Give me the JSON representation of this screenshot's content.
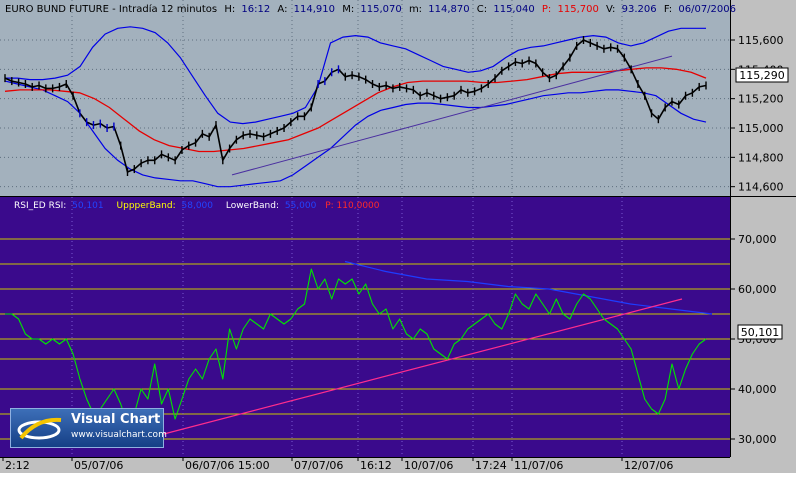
{
  "price_panel": {
    "header": {
      "symbol": "EURO BUND FUTURE - Intradía 12 minutos",
      "hour_label": "H:",
      "hour": "16:12",
      "open_label": "A:",
      "open": "114,910",
      "high_label": "M:",
      "high": "115,070",
      "low_label": "m:",
      "low": "114,870",
      "close_label": "C:",
      "close": "115,040",
      "p_label": "P:",
      "p": "115,700",
      "volume_label": "V:",
      "volume": "93.206",
      "date_label": "F:",
      "date": "06/07/2006"
    },
    "last_value_label": "115,290",
    "colors": {
      "background": "#a3b1bd",
      "price": "#000000",
      "price_alt": "#0000c8",
      "bands": "#0000e6",
      "average": "#e60000",
      "trendline": "#4a2fa0",
      "axis": "#000000"
    }
  },
  "rsi_panel": {
    "header": {
      "rsi_label": "RSI_ED RSI:",
      "rsi_value": "50,101",
      "upper_label": "UppperBand:",
      "upper_value": "58,000",
      "lower_label": "LowerBand:",
      "lower_value": "55,000",
      "p_text": "P: 110,0000"
    },
    "last_value_label": "50,101",
    "colors": {
      "background": "#3a0a8c",
      "rsi": "#00e600",
      "bands": "#1e3cff",
      "trendline": "#ff2d8c",
      "levels": "#c8c800",
      "header_text": "#ffffff"
    }
  },
  "x_axis": {
    "labels": [
      "2:12",
      "05/07/06",
      "06/07/06 15:00",
      "07/07/06",
      "16:12",
      "10/07/06",
      "17:24",
      "11/07/06",
      "12/07/06"
    ]
  },
  "logo": {
    "title": "Visual Chart",
    "url": "www.visualchart.com"
  },
  "chart_data": [
    {
      "type": "line",
      "title": "EURO BUND FUTURE - Intradía 12 minutos",
      "ylim": [
        114.55,
        115.75
      ],
      "y_ticks": [
        "115,600",
        "115,400",
        "115,200",
        "115,000",
        "114,800",
        "114,600"
      ],
      "y_tick_values": [
        115.6,
        115.4,
        115.2,
        115.0,
        114.8,
        114.6
      ],
      "series": [
        {
          "name": "Price",
          "values": [
            115.34,
            115.32,
            115.31,
            115.3,
            115.28,
            115.29,
            115.27,
            115.27,
            115.28,
            115.3,
            115.22,
            115.1,
            115.04,
            115.02,
            115.03,
            115.0,
            115.01,
            114.88,
            114.7,
            114.72,
            114.76,
            114.78,
            114.78,
            114.82,
            114.8,
            114.78,
            114.85,
            114.88,
            114.9,
            114.96,
            114.94,
            115.02,
            114.78,
            114.86,
            114.92,
            114.95,
            114.96,
            114.95,
            114.94,
            114.96,
            114.98,
            115.0,
            115.04,
            115.08,
            115.08,
            115.14,
            115.3,
            115.32,
            115.38,
            115.4,
            115.35,
            115.36,
            115.35,
            115.33,
            115.3,
            115.28,
            115.29,
            115.27,
            115.28,
            115.27,
            115.26,
            115.22,
            115.24,
            115.22,
            115.2,
            115.21,
            115.22,
            115.26,
            115.24,
            115.25,
            115.27,
            115.3,
            115.34,
            115.39,
            115.42,
            115.45,
            115.44,
            115.46,
            115.44,
            115.38,
            115.34,
            115.36,
            115.42,
            115.48,
            115.56,
            115.6,
            115.58,
            115.56,
            115.54,
            115.55,
            115.54,
            115.48,
            115.4,
            115.3,
            115.22,
            115.1,
            115.06,
            115.14,
            115.18,
            115.16,
            115.22,
            115.24,
            115.28,
            115.29
          ]
        },
        {
          "name": "Upper band",
          "values": [
            115.34,
            115.34,
            115.33,
            115.33,
            115.34,
            115.36,
            115.42,
            115.55,
            115.64,
            115.68,
            115.69,
            115.68,
            115.65,
            115.58,
            115.48,
            115.35,
            115.22,
            115.1,
            115.04,
            115.03,
            115.04,
            115.06,
            115.08,
            115.1,
            115.14,
            115.28,
            115.58,
            115.62,
            115.63,
            115.62,
            115.58,
            115.56,
            115.54,
            115.5,
            115.46,
            115.42,
            115.4,
            115.38,
            115.39,
            115.42,
            115.48,
            115.53,
            115.55,
            115.56,
            115.58,
            115.6,
            115.62,
            115.63,
            115.62,
            115.58,
            115.56,
            115.58,
            115.62,
            115.66,
            115.68,
            115.68,
            115.68
          ]
        },
        {
          "name": "Lower band",
          "values": [
            115.32,
            115.3,
            115.28,
            115.26,
            115.22,
            115.18,
            115.1,
            114.98,
            114.86,
            114.78,
            114.72,
            114.68,
            114.66,
            114.65,
            114.64,
            114.64,
            114.62,
            114.6,
            114.6,
            114.61,
            114.62,
            114.63,
            114.64,
            114.68,
            114.74,
            114.8,
            114.86,
            114.94,
            115.02,
            115.08,
            115.12,
            115.14,
            115.16,
            115.17,
            115.17,
            115.16,
            115.15,
            115.14,
            115.14,
            115.15,
            115.16,
            115.18,
            115.2,
            115.22,
            115.23,
            115.24,
            115.24,
            115.25,
            115.26,
            115.26,
            115.25,
            115.24,
            115.22,
            115.16,
            115.1,
            115.06,
            115.04
          ]
        },
        {
          "name": "Moving average",
          "values": [
            115.25,
            115.26,
            115.26,
            115.26,
            115.25,
            115.24,
            115.2,
            115.14,
            115.06,
            114.98,
            114.92,
            114.88,
            114.86,
            114.84,
            114.84,
            114.85,
            114.86,
            114.88,
            114.9,
            114.92,
            114.96,
            115.0,
            115.06,
            115.12,
            115.18,
            115.24,
            115.28,
            115.31,
            115.32,
            115.32,
            115.32,
            115.32,
            115.31,
            115.31,
            115.32,
            115.33,
            115.35,
            115.37,
            115.38,
            115.38,
            115.38,
            115.39,
            115.4,
            115.41,
            115.41,
            115.4,
            115.38,
            115.34
          ]
        },
        {
          "name": "Trendline",
          "values": [
            114.68,
            115.49
          ]
        }
      ]
    },
    {
      "type": "line",
      "title": "RSI_ED RSI",
      "ylim": [
        27,
        75
      ],
      "y_ticks": [
        "70,000",
        "60,000",
        "50,000",
        "40,000",
        "30,000"
      ],
      "y_tick_values": [
        70,
        60,
        50,
        40,
        30
      ],
      "levels": [
        70,
        65,
        60,
        55,
        50,
        46,
        40,
        35,
        30
      ],
      "series": [
        {
          "name": "RSI",
          "values": [
            55,
            55,
            54,
            51,
            50,
            50,
            49,
            50,
            49,
            50,
            47,
            42,
            38,
            35,
            36,
            38,
            40,
            37,
            33,
            35,
            40,
            38,
            45,
            37,
            40,
            34,
            38,
            42,
            44,
            42,
            46,
            48,
            42,
            52,
            48,
            52,
            54,
            53,
            52,
            55,
            54,
            53,
            54,
            56,
            57,
            64,
            60,
            62,
            58,
            62,
            61,
            62,
            59,
            61,
            57,
            55,
            56,
            52,
            54,
            51,
            50,
            52,
            51,
            48,
            47,
            46,
            49,
            50,
            52,
            53,
            54,
            55,
            53,
            52,
            55,
            59,
            57,
            56,
            59,
            57,
            55,
            58,
            55,
            54,
            57,
            59,
            58,
            56,
            54,
            53,
            52,
            50,
            48,
            43,
            38,
            36,
            35,
            38,
            45,
            40,
            44,
            47,
            49,
            50
          ]
        },
        {
          "name": "Upper band",
          "values": [
            65.5,
            63.5,
            62.0,
            61.5,
            60.5,
            60.0,
            58.5,
            57.0,
            56.0,
            55.0
          ]
        },
        {
          "name": "Trendline",
          "values": [
            30.8,
            58.0
          ]
        }
      ]
    }
  ]
}
